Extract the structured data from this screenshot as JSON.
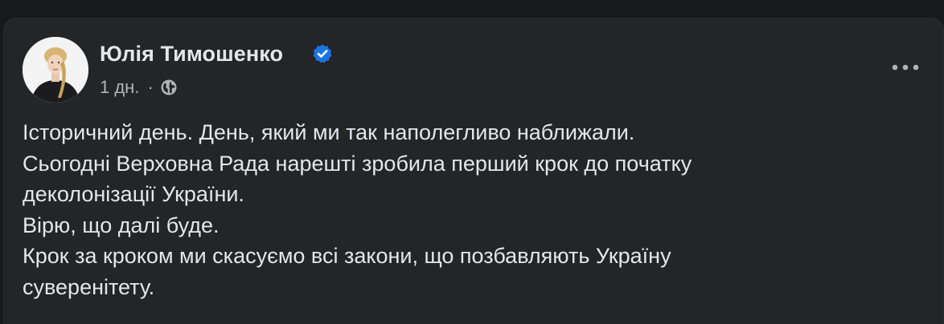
{
  "post": {
    "author_name": "Юлія Тимошенко",
    "verified": true,
    "time": "1 дн.",
    "separator": "·",
    "audience_icon": "globe-icon",
    "menu_icon": "more-horizontal-icon",
    "text_lines": [
      "Історичний день. День, який ми так наполегливо наближали.",
      "Сьогодні Верховна Рада нарешті зробила перший крок до початку",
      "деколонізації України.",
      "Вірю, що далі буде.",
      "Крок за кроком ми скасуємо всі закони, що позбавляють Україну",
      "суверенітету."
    ]
  },
  "colors": {
    "background": "#18191a",
    "card": "#242526",
    "primary_text": "#e4e6eb",
    "secondary_text": "#b0b3b8",
    "verified_badge": "#1b74e4"
  }
}
